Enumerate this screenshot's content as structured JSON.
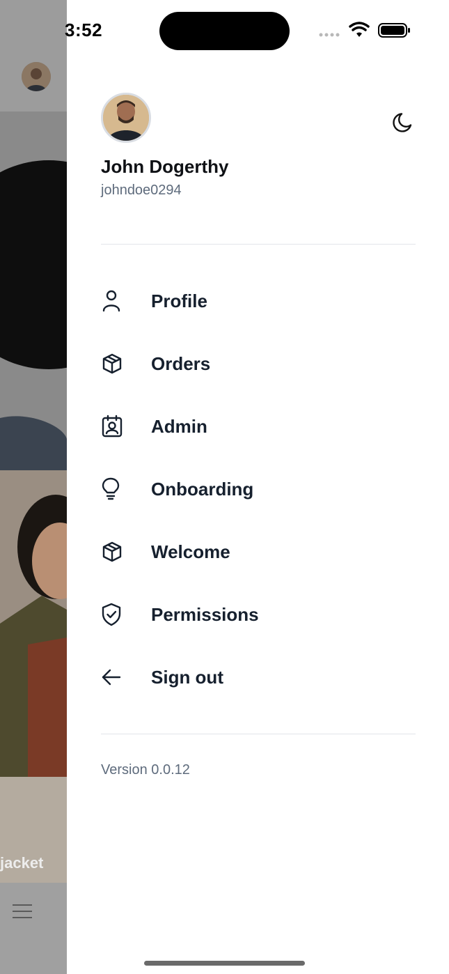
{
  "status_bar": {
    "time": "3:52"
  },
  "background": {
    "card_label": "jacket"
  },
  "drawer": {
    "user": {
      "name": "John Dogerthy",
      "handle": "johndoe0294"
    },
    "theme_toggle_icon": "moon-icon",
    "menu": [
      {
        "label": "Profile",
        "icon": "user-icon"
      },
      {
        "label": "Orders",
        "icon": "package-icon"
      },
      {
        "label": "Admin",
        "icon": "badge-icon"
      },
      {
        "label": "Onboarding",
        "icon": "lightbulb-icon"
      },
      {
        "label": "Welcome",
        "icon": "package-icon"
      },
      {
        "label": "Permissions",
        "icon": "shield-check-icon"
      },
      {
        "label": "Sign out",
        "icon": "arrow-left-icon"
      }
    ],
    "version": "Version 0.0.12"
  },
  "colors": {
    "text_primary": "#16202e",
    "text_secondary": "#5e6b7c",
    "divider": "#e2e5e9"
  }
}
